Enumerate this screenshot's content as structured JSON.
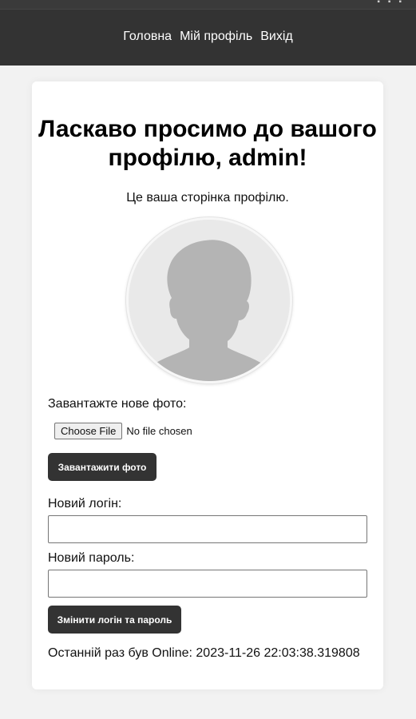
{
  "nav": {
    "items": [
      {
        "label": "Головна"
      },
      {
        "label": "Мій профіль"
      },
      {
        "label": "Вихід"
      }
    ]
  },
  "profile": {
    "title": "Ласкаво просимо до вашого профілю, admin!",
    "subtitle": "Це ваша сторінка профілю.",
    "avatar_icon": "person-silhouette-icon"
  },
  "upload": {
    "label": "Завантажте нове фото:",
    "choose_file_label": "Choose File",
    "file_status": "No file chosen",
    "submit_label": "Завантажити фото"
  },
  "credentials": {
    "login_label": "Новий логін:",
    "login_value": "",
    "password_label": "Новий пароль:",
    "password_value": "",
    "submit_label": "Змінити логін та пароль"
  },
  "status": {
    "last_online": "Останній раз був Online: 2023-11-26 22:03:38.319808"
  },
  "colors": {
    "header_bg": "#333333",
    "page_bg": "#f2f2f2",
    "card_bg": "#ffffff",
    "button_bg": "#333333",
    "button_text": "#ffffff"
  }
}
